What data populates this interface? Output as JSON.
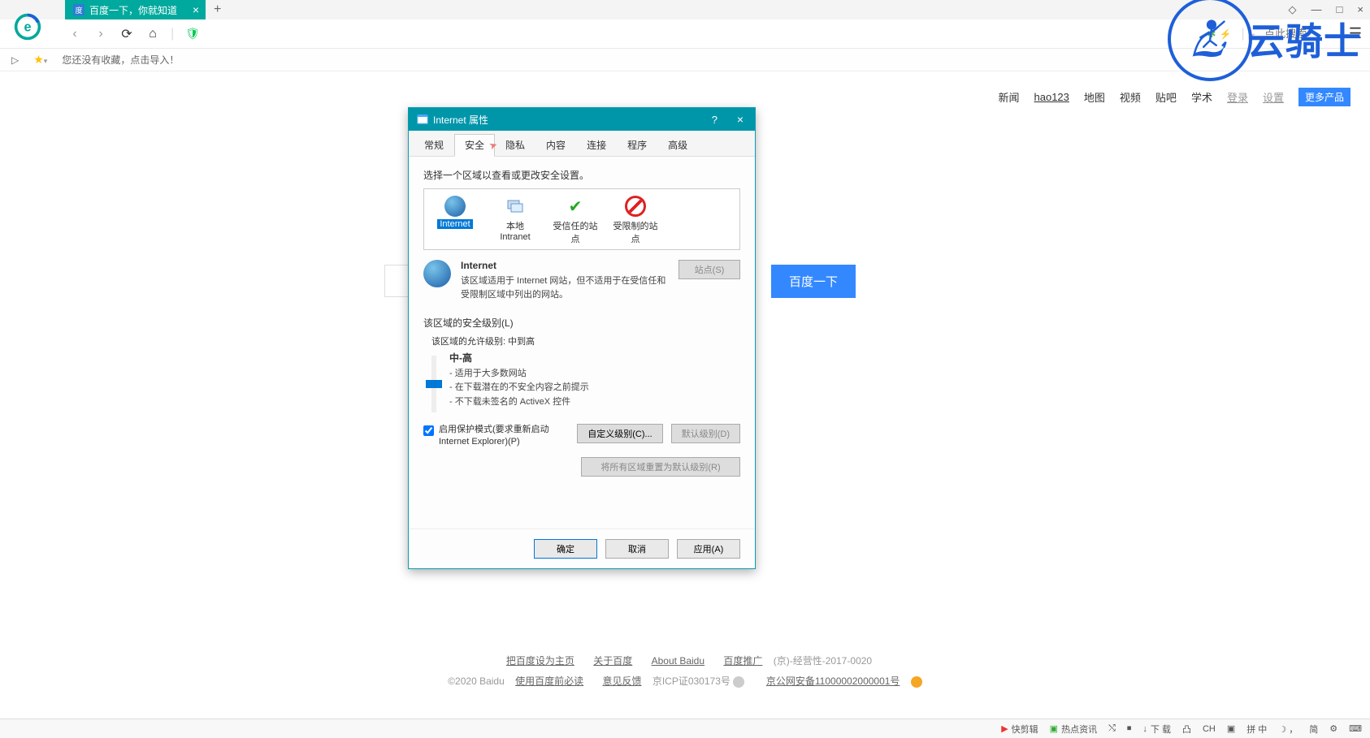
{
  "tab": {
    "title": "百度一下，你就知道",
    "close": "×",
    "new": "+"
  },
  "win": {
    "restore": "◇",
    "min": "—",
    "max": "□",
    "close": "×"
  },
  "nav": {
    "back": "‹",
    "forward": "›",
    "reload": "⟳",
    "home": "⌂"
  },
  "searchPlaceholder": "点此搜索",
  "bookmark": {
    "empty": "您还没有收藏，点击导入！"
  },
  "topnav": {
    "news": "新闻",
    "hao123": "hao123",
    "map": "地图",
    "video": "视频",
    "tieba": "贴吧",
    "xueshu": "学术",
    "login": "登录",
    "settings": "设置",
    "more": "更多产品"
  },
  "baiduBtn": "百度一下",
  "footer": {
    "setHome": "把百度设为主页",
    "about": "关于百度",
    "aboutEn": "About  Baidu",
    "promo": "百度推广",
    "license": "(京)-经营性-2017-0020",
    "copy": "©2020 Baidu ",
    "mustread": "使用百度前必读",
    "feedback": "意见反馈",
    "icp": " 京ICP证030173号 ",
    "beian": "京公网安备11000002000001号"
  },
  "dialog": {
    "title": "Internet 属性",
    "tabs": {
      "general": "常规",
      "security": "安全",
      "privacy": "隐私",
      "content": "内容",
      "connections": "连接",
      "programs": "程序",
      "advanced": "高级"
    },
    "zonePrompt": "选择一个区域以查看或更改安全设置。",
    "zones": {
      "internet": "Internet",
      "intranet": "本地\nIntranet",
      "trusted": "受信任的站点",
      "restricted": "受限制的站点"
    },
    "zoneDetail": {
      "name": "Internet",
      "desc": "该区域适用于 Internet 网站，但不适用于在受信任和受限制区域中列出的网站。",
      "sitesBtn": "站点(S)"
    },
    "secLevel": {
      "header": "该区域的安全级别(L)",
      "allowed": "该区域的允许级别: 中到高",
      "level": "中-高",
      "i1": "- 适用于大多数网站",
      "i2": "- 在下载潜在的不安全内容之前提示",
      "i3": "- 不下载未签名的 ActiveX 控件"
    },
    "protect": "启用保护模式(要求重新启动 Internet Explorer)(P)",
    "customBtn": "自定义级别(C)...",
    "defaultBtn": "默认级别(D)",
    "resetBtn": "将所有区域重置为默认级别(R)",
    "ok": "确定",
    "cancel": "取消",
    "apply": "应用(A)"
  },
  "watermark": "云骑士",
  "taskbar": {
    "quick": "快剪辑",
    "hot": "热点资讯",
    "down": "下 载",
    "ch": "CH",
    "ime": "拼 中 ",
    "simp": "简"
  }
}
